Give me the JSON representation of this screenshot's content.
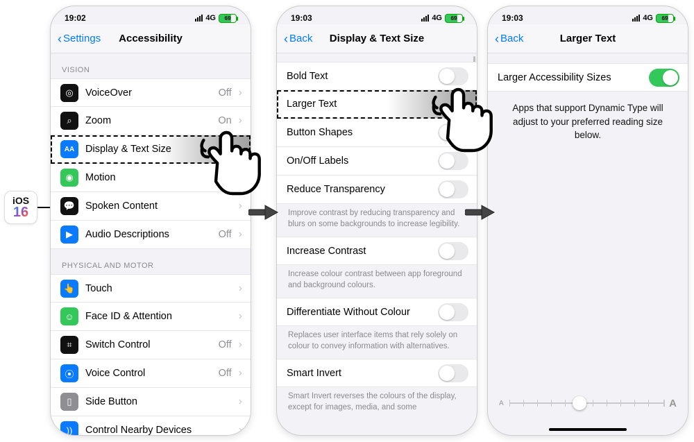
{
  "ios_badge": {
    "top": "iOS",
    "num": "16"
  },
  "status": {
    "time1": "19:02",
    "time2": "19:03",
    "time3": "19:03",
    "net": "4G",
    "batt": "69"
  },
  "phone1": {
    "back": "Settings",
    "title": "Accessibility",
    "section1": "VISION",
    "rows1": [
      {
        "label": "VoiceOver",
        "value": "Off"
      },
      {
        "label": "Zoom",
        "value": "On"
      },
      {
        "label": "Display & Text Size",
        "value": ""
      },
      {
        "label": "Motion",
        "value": ""
      },
      {
        "label": "Spoken Content",
        "value": ""
      },
      {
        "label": "Audio Descriptions",
        "value": "Off"
      }
    ],
    "section2": "PHYSICAL AND MOTOR",
    "rows2": [
      {
        "label": "Touch",
        "value": ""
      },
      {
        "label": "Face ID & Attention",
        "value": ""
      },
      {
        "label": "Switch Control",
        "value": "Off"
      },
      {
        "label": "Voice Control",
        "value": "Off"
      },
      {
        "label": "Side Button",
        "value": ""
      },
      {
        "label": "Control Nearby Devices",
        "value": ""
      }
    ]
  },
  "phone2": {
    "back": "Back",
    "title": "Display & Text Size",
    "rows": [
      {
        "label": "Bold Text",
        "toggle": false
      },
      {
        "label": "Larger Text",
        "nav": true
      },
      {
        "label": "Button Shapes",
        "toggle": false
      },
      {
        "label": "On/Off Labels",
        "toggle": false
      },
      {
        "label": "Reduce Transparency",
        "toggle": false
      }
    ],
    "note1": "Improve contrast by reducing transparency and blurs on some backgrounds to increase legibility.",
    "rows2": [
      {
        "label": "Increase Contrast",
        "toggle": false
      }
    ],
    "note2": "Increase colour contrast between app foreground and background colours.",
    "rows3": [
      {
        "label": "Differentiate Without Colour",
        "toggle": false
      }
    ],
    "note3": "Replaces user interface items that rely solely on colour to convey information with alternatives.",
    "rows4": [
      {
        "label": "Smart Invert",
        "toggle": false
      }
    ],
    "note4": "Smart Invert reverses the colours of the display, except for images, media, and some"
  },
  "phone3": {
    "back": "Back",
    "title": "Larger Text",
    "row_label": "Larger Accessibility Sizes",
    "row_toggle": true,
    "desc": "Apps that support Dynamic Type will adjust to your preferred reading size below.",
    "a_small": "A",
    "a_large": "A"
  }
}
